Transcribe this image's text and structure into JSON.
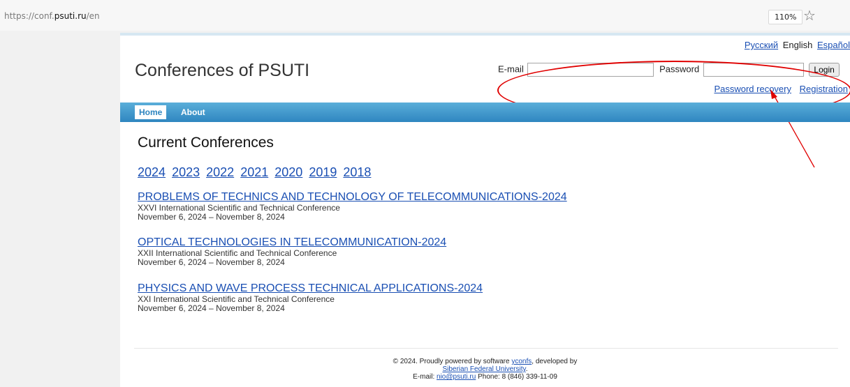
{
  "browser": {
    "url_prefix": "https://conf.",
    "url_host": "psuti.ru",
    "url_suffix": "/en",
    "zoom": "110%"
  },
  "header": {
    "title": "Conferences of PSUTI",
    "languages": [
      "Русский",
      "English",
      "Español"
    ]
  },
  "login": {
    "email_label": "E-mail",
    "password_label": "Password",
    "button": "Login",
    "recovery": "Password recovery",
    "registration": "Registration"
  },
  "nav": {
    "home": "Home",
    "about": "About"
  },
  "main": {
    "title": "Current Conferences",
    "years": [
      "2024",
      "2023",
      "2022",
      "2021",
      "2020",
      "2019",
      "2018"
    ],
    "conferences": [
      {
        "name": "PROBLEMS OF TECHNICS AND TECHNOLOGY OF TELECOMMUNICATIONS-2024",
        "subtitle": "XXVI International Scientific and Technical Conference",
        "dates": "November 6, 2024 – November 8, 2024"
      },
      {
        "name": "OPTICAL TECHNOLOGIES IN TELECOMMUNICATION-2024",
        "subtitle": "XXII International Scientific and Technical Conference",
        "dates": "November 6, 2024 – November 8, 2024"
      },
      {
        "name": "PHYSICS AND WAVE PROCESS TECHNICAL APPLICATIONS-2024",
        "subtitle": "XXI International Scientific and Technical Conference",
        "dates": "November 6, 2024 – November 8, 2024"
      }
    ]
  },
  "footer": {
    "line1_prefix": "© 2024. Proudly powered by software ",
    "software": "yconfs",
    "line1_suffix": ", developed by",
    "university": "Siberian Federal University",
    "university_suffix": ".",
    "email_label": "E-mail: ",
    "email": "nio@psuti.ru",
    "phone": "Phone: 8 (846) 339-11-09"
  },
  "colors": {
    "link": "#1a4fb3",
    "nav_bar": "#3b91c7",
    "annotation": "#e00000"
  },
  "icons": [
    "star-icon"
  ]
}
